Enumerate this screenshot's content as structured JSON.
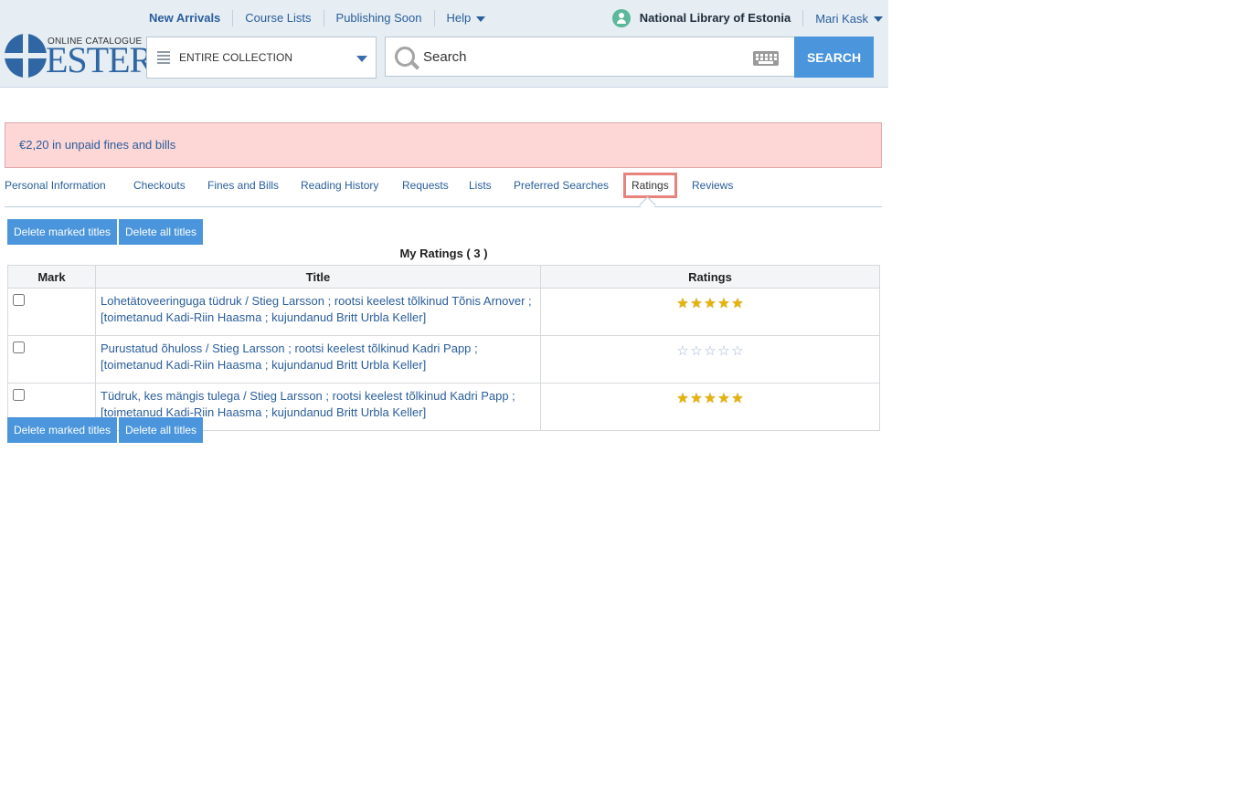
{
  "header": {
    "nav": [
      "New Arrivals",
      "Course Lists",
      "Publishing Soon",
      "Help"
    ],
    "library_name": "National Library of Estonia",
    "user_name": "Mari Kask",
    "logo_subtitle": "ONLINE CATALOGUE",
    "logo_title": "ESTER",
    "scope_label": "ENTIRE COLLECTION",
    "search_placeholder": "Search",
    "search_button": "SEARCH"
  },
  "alert": {
    "text": "€2,20 in unpaid fines and bills"
  },
  "tabs": [
    {
      "label": "Personal Information"
    },
    {
      "label": "Checkouts"
    },
    {
      "label": "Fines and Bills"
    },
    {
      "label": "Reading History"
    },
    {
      "label": "Requests"
    },
    {
      "label": "Lists"
    },
    {
      "label": "Preferred Searches"
    },
    {
      "label": "Ratings",
      "active": true
    },
    {
      "label": "Reviews"
    }
  ],
  "actions": {
    "delete_marked": "Delete marked titles",
    "delete_all": "Delete all titles"
  },
  "ratings": {
    "caption": "My Ratings ( 3 )",
    "columns": [
      "Mark",
      "Title",
      "Ratings"
    ],
    "rows": [
      {
        "title": "Lohetätoveeringuga tüdruk / Stieg Larsson ; rootsi keelest tõlkinud Tõnis Arnover ; [toimetanud Kadi-Riin Haasma ; kujundanud Britt Urbla Keller]",
        "stars": 5,
        "max": 5
      },
      {
        "title": "Purustatud õhuloss / Stieg Larsson ; rootsi keelest tõlkinud Kadri Papp ; [toimetanud Kadi-Riin Haasma ; kujundanud Britt Urbla Keller]",
        "stars": 0,
        "max": 5
      },
      {
        "title": "Tüdruk, kes mängis tulega / Stieg Larsson ; rootsi keelest tõlkinud Kadri Papp ; [toimetanud Kadi-Riin Haasma ; kujundanud Britt Urbla Keller]",
        "stars": 5,
        "max": 5
      }
    ]
  },
  "colors": {
    "accent": "#4a95db",
    "link": "#2a5e9b",
    "alert_bg": "#fdd6d6",
    "active_tab_border": "#e8827c",
    "star_on": "#e8b400",
    "star_off": "#9fb4d8"
  },
  "icons": [
    "library-user-icon",
    "scope-list-icon",
    "search-icon",
    "keyboard-icon",
    "chevron-down-icon",
    "star-icon"
  ]
}
